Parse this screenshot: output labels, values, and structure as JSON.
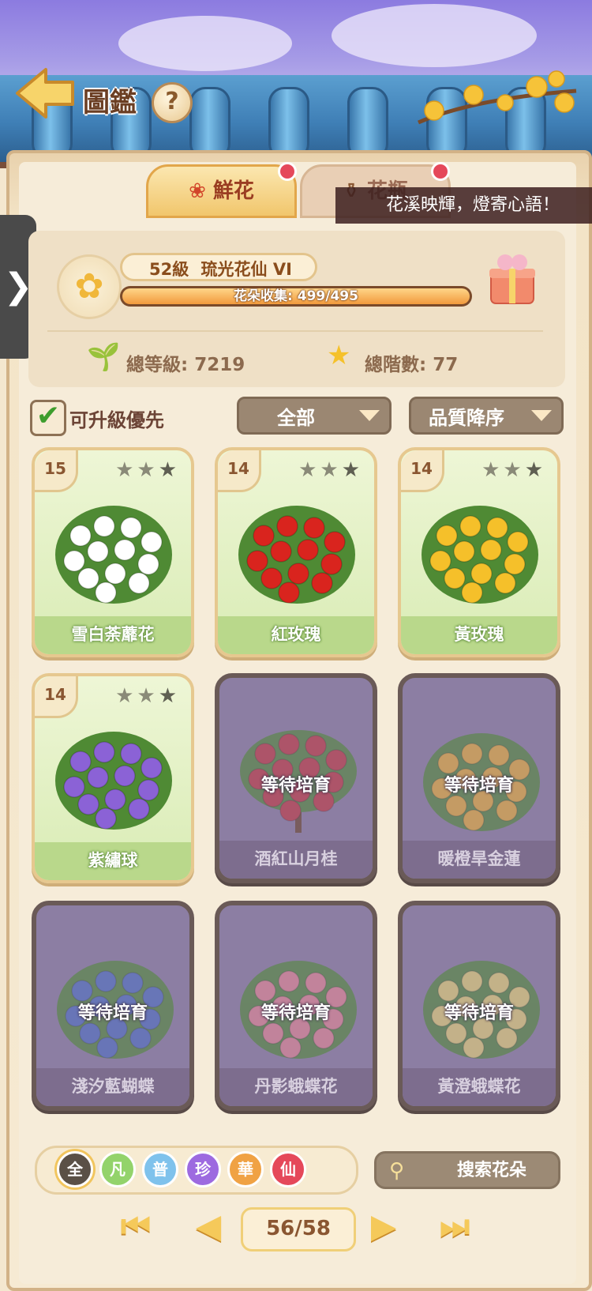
{
  "header": {
    "title": "圖鑑",
    "help_label": "?"
  },
  "tabs": [
    {
      "label": "鮮花",
      "icon": "rose-icon",
      "active": true,
      "badge": true
    },
    {
      "label": "花瓶",
      "icon": "vase-icon",
      "active": false,
      "badge": true
    }
  ],
  "marquee": "花溪映輝，燈寄心語！",
  "side_handle": "❯",
  "profile": {
    "level_label": "52級",
    "rank_title": "琉光花仙 VI",
    "collect_text": "花朵收集: 499/495",
    "collect_fraction": 1.0,
    "total_level_label": "總等級: 7219",
    "total_stars_label": "總階數: 77"
  },
  "filters": {
    "upgrade_first_label": "可升級優先",
    "upgrade_first_checked": true,
    "category": "全部",
    "sort": "品質降序"
  },
  "cards": [
    {
      "name": "雪白荼蘼花",
      "level": "15",
      "owned": true,
      "stars": 2,
      "flower_color": "#ffffff",
      "icon": "white-flower-bush-icon"
    },
    {
      "name": "紅玫瑰",
      "level": "14",
      "owned": true,
      "stars": 2,
      "flower_color": "#d9241e",
      "icon": "red-rose-bush-icon"
    },
    {
      "name": "黃玫瑰",
      "level": "14",
      "owned": true,
      "stars": 2,
      "flower_color": "#f5c02a",
      "icon": "yellow-rose-bush-icon"
    },
    {
      "name": "紫繡球",
      "level": "14",
      "owned": true,
      "stars": 2,
      "flower_color": "#8b62d6",
      "icon": "hydrangea-icon"
    },
    {
      "name": "酒紅山月桂",
      "owned": false,
      "wait_label": "等待培育",
      "flower_color": "#c9323a",
      "icon": "laurel-tree-icon"
    },
    {
      "name": "暖橙旱金蓮",
      "owned": false,
      "wait_label": "等待培育",
      "flower_color": "#f3b431",
      "icon": "nasturtium-icon"
    },
    {
      "name": "淺汐藍蝴蝶",
      "owned": false,
      "wait_label": "等待培育",
      "flower_color": "#4b6fc8",
      "icon": "blue-butterfly-flower-icon"
    },
    {
      "name": "丹影蛾蝶花",
      "owned": false,
      "wait_label": "等待培育",
      "flower_color": "#ee8896",
      "icon": "pink-moth-flower-icon"
    },
    {
      "name": "黃澄蛾蝶花",
      "owned": false,
      "wait_label": "等待培育",
      "flower_color": "#f0dc74",
      "icon": "yellow-moth-flower-icon"
    }
  ],
  "rarity_filters": [
    {
      "label": "全",
      "color": "#5a5046",
      "active": true
    },
    {
      "label": "凡",
      "color": "#93d36b",
      "active": false
    },
    {
      "label": "普",
      "color": "#7fc2ec",
      "active": false
    },
    {
      "label": "珍",
      "color": "#9d6ae0",
      "active": false
    },
    {
      "label": "華",
      "color": "#f0a244",
      "active": false
    },
    {
      "label": "仙",
      "color": "#e5485a",
      "active": false
    }
  ],
  "search_label": "搜索花朵",
  "pagination": {
    "current": "56/58"
  }
}
